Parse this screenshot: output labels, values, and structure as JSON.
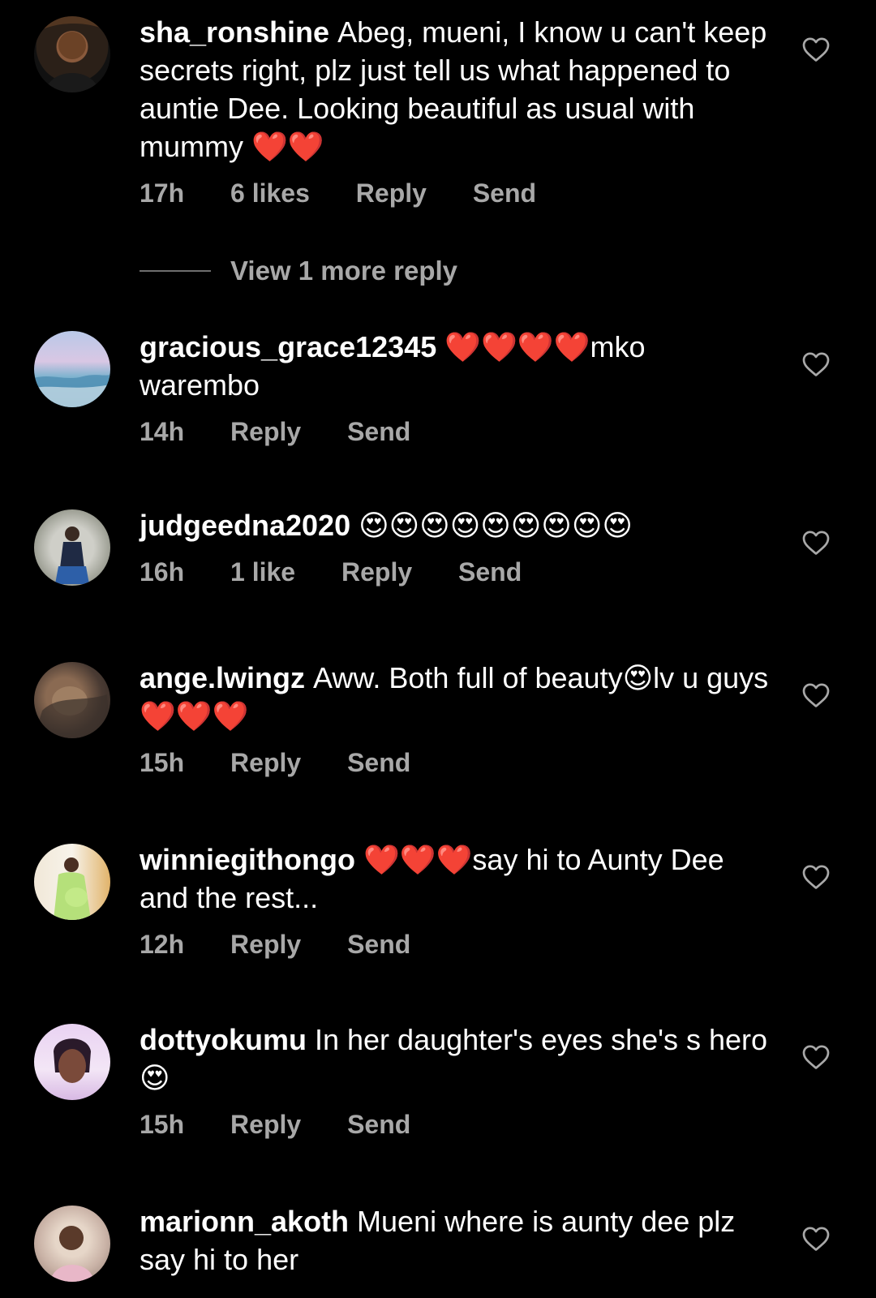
{
  "comments": [
    {
      "username": "sha_ronshine",
      "text": "Abeg, mueni, I know u can't keep secrets right, plz just tell us what happened to auntie Dee. Looking beautiful as usual with mummy ❤️❤️",
      "time": "17h",
      "likes": "6 likes",
      "reply": "Reply",
      "send": "Send",
      "view_more": "View 1 more reply"
    },
    {
      "username": "gracious_grace12345",
      "text": "❤️❤️❤️❤️mko warembo",
      "time": "14h",
      "likes": "",
      "reply": "Reply",
      "send": "Send"
    },
    {
      "username": "judgeedna2020",
      "text": "😍😍😍😍😍😍😍😍😍",
      "time": "16h",
      "likes": "1 like",
      "reply": "Reply",
      "send": "Send"
    },
    {
      "username": "ange.lwingz",
      "text": "Aww. Both full of beauty😍lv u guys❤️❤️❤️",
      "time": "15h",
      "likes": "",
      "reply": "Reply",
      "send": "Send"
    },
    {
      "username": "winniegithongo",
      "text": "❤️❤️❤️say hi to Aunty Dee and the rest...",
      "time": "12h",
      "likes": "",
      "reply": "Reply",
      "send": "Send"
    },
    {
      "username": "dottyokumu",
      "text": "In her daughter's eyes she's s hero😍",
      "time": "15h",
      "likes": "",
      "reply": "Reply",
      "send": "Send"
    },
    {
      "username": "marionn_akoth",
      "text": "Mueni where is aunty dee plz say hi to her",
      "time": "",
      "likes": "",
      "reply": "",
      "send": ""
    }
  ],
  "colors": {
    "background": "#000000",
    "text": "#ffffff",
    "muted": "#a8a8a8"
  },
  "icons": {
    "heart": "heart-outline-icon"
  }
}
